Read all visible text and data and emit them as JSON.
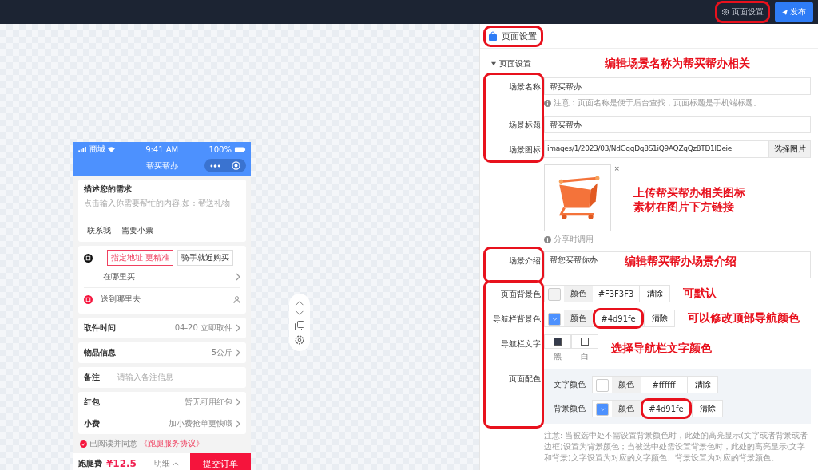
{
  "top_bar": {
    "settings_button": {
      "label": "页面设置",
      "circled": true
    },
    "publish_button": "发布"
  },
  "phone": {
    "status_bar": {
      "carrier": "商城",
      "time": "9:41 AM",
      "battery": "100%"
    },
    "nav_title": "帮买帮办",
    "need_card": {
      "title": "描述您的需求",
      "placeholder": "点击输入你需要帮忙的内容,如：帮送礼物",
      "tags": [
        "联系我",
        "需要小票"
      ]
    },
    "address_card": {
      "modes": [
        {
          "label": "指定地址 更精准",
          "selected": true
        },
        {
          "label": "骑手就近购买",
          "selected": false
        }
      ],
      "buy_from": "在哪里买",
      "deliver_to": "送到哪里去"
    },
    "cards": [
      [
        {
          "kind": "link",
          "label": "取件时间",
          "value": "04-20 立即取件"
        }
      ],
      [
        {
          "kind": "link",
          "label": "物品信息",
          "value": "5公斤"
        }
      ],
      [
        {
          "kind": "input",
          "label": "备注",
          "placeholder": "请输入备注信息"
        }
      ],
      [
        {
          "kind": "link",
          "label": "红包",
          "value": "暂无可用红包"
        },
        {
          "kind": "link",
          "label": "小费",
          "value": "加小费抢单更快哦"
        }
      ]
    ],
    "agreement": {
      "checked": true,
      "text": "已阅读并同意",
      "link": "《跑腿服务协议》"
    },
    "bottom_bar": {
      "fee_label": "跑腿费",
      "price": "¥12.5",
      "detail": "明细",
      "submit": "提交订单"
    }
  },
  "panel": {
    "title": "页面设置",
    "circled": true,
    "section": "页面设置",
    "expanded": true,
    "note": "编辑场景名称为帮买帮办相关",
    "groups": [
      {
        "circled": true,
        "fields": [
          {
            "kind": "text",
            "label": "场景名称",
            "value": "帮买帮办",
            "hint": "注意：页面名称是便于后台查找，页面标题是手机端标题。"
          },
          {
            "kind": "text",
            "label": "场景标题",
            "value": "帮买帮办"
          },
          {
            "kind": "path",
            "label": "场景图标",
            "value": "images/1/2023/03/NdGqqDq8S1iQ9AQZqQz8TD1lDeie",
            "button": "选择图片"
          }
        ]
      },
      {
        "circled": false,
        "fields": [
          {
            "kind": "preview",
            "close": "×",
            "hint": "分享时调用",
            "note": "上传帮买帮办相关图标素材在图片下方链接"
          }
        ]
      },
      {
        "circled": true,
        "fields": [
          {
            "kind": "textarea",
            "label": "场景介绍",
            "value": "帮您买帮你办",
            "note": "编辑帮买帮办场景介绍"
          }
        ]
      },
      {
        "circled": true,
        "fields": [
          {
            "kind": "color",
            "label": "页面背景色",
            "swatch_label": "颜色",
            "value": "#F3F3F3",
            "clear": "清除",
            "value_circled": false,
            "note": "可默认"
          },
          {
            "kind": "color",
            "label": "导航栏背景色",
            "swatch_label": "颜色",
            "value": "#4d91fe",
            "clear": "清除",
            "value_circled": true,
            "note": "可以修改顶部导航颜色"
          },
          {
            "kind": "choice",
            "label": "导航栏文字",
            "options": [
              {
                "label": "黑",
                "color": "#353b4b"
              },
              {
                "label": "白",
                "color": "#ffffff"
              }
            ],
            "note": "选择导航栏文字颜色"
          },
          {
            "kind": "palette",
            "label": "页面配色",
            "rows": [
              {
                "label": "文字颜色",
                "swatch_label": "颜色",
                "value": "#ffffff",
                "clear": "清除",
                "value_circled": false
              },
              {
                "label": "背景颜色",
                "swatch_label": "颜色",
                "value": "#4d91fe",
                "clear": "清除",
                "value_circled": true
              }
            ]
          }
        ]
      },
      {
        "circled": false,
        "fields": [
          {
            "kind": "hint",
            "hint": "注意: 当被选中处不需设置背景颜色时，此处的高亮显示(文字或者背景或者边框)设置为背景颜色；当被选中处需设置背景色时，此处的高亮显示(文字和背景)文字设置为对应的文字颜色、背景设置为对应的背景颜色。"
          }
        ]
      }
    ]
  }
}
